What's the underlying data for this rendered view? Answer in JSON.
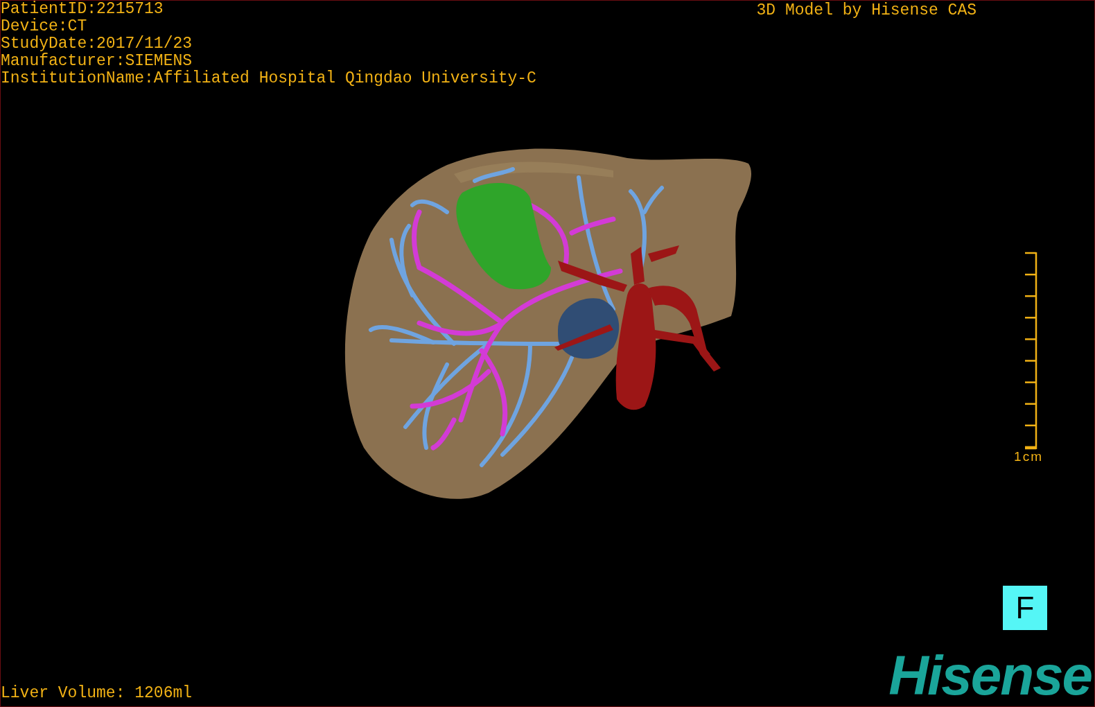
{
  "patient_info": [
    "PatientID:2215713",
    "Device:CT",
    "StudyDate:2017/11/23",
    "Manufacturer:SIEMENS",
    "InstitutionName:Affiliated Hospital Qingdao University-C"
  ],
  "model_credit": "3D Model by Hisense CAS",
  "scale_bar": {
    "label": "1cm"
  },
  "liver_volume": "Liver Volume: 1206ml",
  "orientation_button": "F",
  "logo": "Hisense"
}
